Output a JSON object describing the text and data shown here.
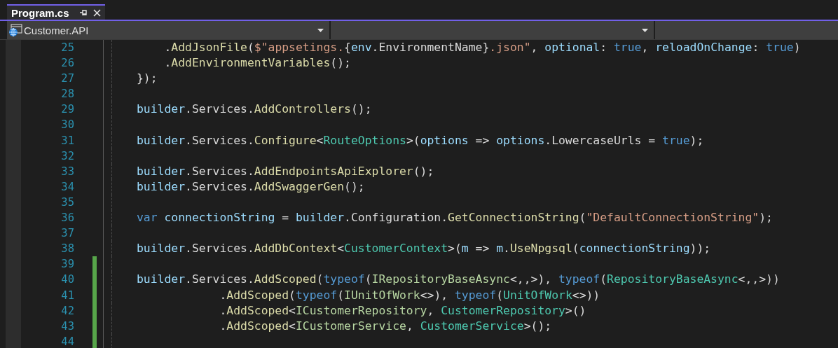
{
  "tab": {
    "title": "Program.cs",
    "selected": true
  },
  "project_dropdown": {
    "value": "Customer.API"
  },
  "lines": [
    {
      "number": "25",
      "modified": false,
      "tokens": [
        {
          "kind": "plain",
          "text": "    ."
        },
        {
          "kind": "method",
          "text": "AddJsonFile"
        },
        {
          "kind": "plain",
          "text": "("
        },
        {
          "kind": "string",
          "text": "$\"appsetings."
        },
        {
          "kind": "plain",
          "text": "{"
        },
        {
          "kind": "variable",
          "text": "env"
        },
        {
          "kind": "plain",
          "text": ".EnvironmentName}"
        },
        {
          "kind": "string",
          "text": ".json\""
        },
        {
          "kind": "plain",
          "text": ", "
        },
        {
          "kind": "variable",
          "text": "optional"
        },
        {
          "kind": "plain",
          "text": ": "
        },
        {
          "kind": "keyword",
          "text": "true"
        },
        {
          "kind": "plain",
          "text": ", "
        },
        {
          "kind": "variable",
          "text": "reloadOnChange"
        },
        {
          "kind": "plain",
          "text": ": "
        },
        {
          "kind": "keyword",
          "text": "true"
        },
        {
          "kind": "plain",
          "text": ")"
        }
      ]
    },
    {
      "number": "26",
      "modified": false,
      "tokens": [
        {
          "kind": "plain",
          "text": "    ."
        },
        {
          "kind": "method",
          "text": "AddEnvironmentVariables"
        },
        {
          "kind": "plain",
          "text": "();"
        }
      ]
    },
    {
      "number": "27",
      "modified": false,
      "tokens": [
        {
          "kind": "plain",
          "text": "});"
        }
      ]
    },
    {
      "number": "28",
      "modified": false
    },
    {
      "number": "29",
      "modified": false,
      "tokens": [
        {
          "kind": "variable",
          "text": "builder"
        },
        {
          "kind": "plain",
          "text": ".Services."
        },
        {
          "kind": "method",
          "text": "AddControllers"
        },
        {
          "kind": "plain",
          "text": "();"
        }
      ]
    },
    {
      "number": "30",
      "modified": false
    },
    {
      "number": "31",
      "modified": false,
      "tokens": [
        {
          "kind": "variable",
          "text": "builder"
        },
        {
          "kind": "plain",
          "text": ".Services."
        },
        {
          "kind": "method",
          "text": "Configure"
        },
        {
          "kind": "plain",
          "text": "<"
        },
        {
          "kind": "type",
          "text": "RouteOptions"
        },
        {
          "kind": "plain",
          "text": ">("
        },
        {
          "kind": "variable",
          "text": "options"
        },
        {
          "kind": "plain",
          "text": " => "
        },
        {
          "kind": "variable",
          "text": "options"
        },
        {
          "kind": "plain",
          "text": ".LowercaseUrls = "
        },
        {
          "kind": "keyword",
          "text": "true"
        },
        {
          "kind": "plain",
          "text": ");"
        }
      ]
    },
    {
      "number": "32",
      "modified": false
    },
    {
      "number": "33",
      "modified": false,
      "tokens": [
        {
          "kind": "variable",
          "text": "builder"
        },
        {
          "kind": "plain",
          "text": ".Services."
        },
        {
          "kind": "method",
          "text": "AddEndpointsApiExplorer"
        },
        {
          "kind": "plain",
          "text": "();"
        }
      ]
    },
    {
      "number": "34",
      "modified": false,
      "tokens": [
        {
          "kind": "variable",
          "text": "builder"
        },
        {
          "kind": "plain",
          "text": ".Services."
        },
        {
          "kind": "method",
          "text": "AddSwaggerGen"
        },
        {
          "kind": "plain",
          "text": "();"
        }
      ]
    },
    {
      "number": "35",
      "modified": false
    },
    {
      "number": "36",
      "modified": false,
      "tokens": [
        {
          "kind": "keyword",
          "text": "var"
        },
        {
          "kind": "variable",
          "text": " connectionString"
        },
        {
          "kind": "plain",
          "text": " = "
        },
        {
          "kind": "variable",
          "text": "builder"
        },
        {
          "kind": "plain",
          "text": ".Configuration."
        },
        {
          "kind": "method",
          "text": "GetConnectionString"
        },
        {
          "kind": "plain",
          "text": "("
        },
        {
          "kind": "string",
          "text": "\"DefaultConnectionString\""
        },
        {
          "kind": "plain",
          "text": ");"
        }
      ]
    },
    {
      "number": "37",
      "modified": false
    },
    {
      "number": "38",
      "modified": false,
      "tokens": [
        {
          "kind": "variable",
          "text": "builder"
        },
        {
          "kind": "plain",
          "text": ".Services."
        },
        {
          "kind": "method",
          "text": "AddDbContext"
        },
        {
          "kind": "plain",
          "text": "<"
        },
        {
          "kind": "type",
          "text": "CustomerContext"
        },
        {
          "kind": "plain",
          "text": ">("
        },
        {
          "kind": "variable",
          "text": "m"
        },
        {
          "kind": "plain",
          "text": " => "
        },
        {
          "kind": "variable",
          "text": "m"
        },
        {
          "kind": "plain",
          "text": "."
        },
        {
          "kind": "method",
          "text": "UseNpgsql"
        },
        {
          "kind": "plain",
          "text": "("
        },
        {
          "kind": "variable",
          "text": "connectionString"
        },
        {
          "kind": "plain",
          "text": "));"
        }
      ]
    },
    {
      "number": "39",
      "modified": true
    },
    {
      "number": "40",
      "modified": true,
      "tokens": [
        {
          "kind": "variable",
          "text": "builder"
        },
        {
          "kind": "plain",
          "text": ".Services."
        },
        {
          "kind": "method",
          "text": "AddScoped"
        },
        {
          "kind": "plain",
          "text": "("
        },
        {
          "kind": "keyword",
          "text": "typeof"
        },
        {
          "kind": "plain",
          "text": "("
        },
        {
          "kind": "interface",
          "text": "IRepositoryBaseAsync"
        },
        {
          "kind": "plain",
          "text": "<,,>), "
        },
        {
          "kind": "keyword",
          "text": "typeof"
        },
        {
          "kind": "plain",
          "text": "("
        },
        {
          "kind": "type",
          "text": "RepositoryBaseAsync"
        },
        {
          "kind": "plain",
          "text": "<,,>))"
        }
      ]
    },
    {
      "number": "41",
      "modified": true,
      "tokens": [
        {
          "kind": "plain",
          "text": "            ."
        },
        {
          "kind": "method",
          "text": "AddScoped"
        },
        {
          "kind": "plain",
          "text": "("
        },
        {
          "kind": "keyword",
          "text": "typeof"
        },
        {
          "kind": "plain",
          "text": "("
        },
        {
          "kind": "interface",
          "text": "IUnitOfWork"
        },
        {
          "kind": "plain",
          "text": "<>), "
        },
        {
          "kind": "keyword",
          "text": "typeof"
        },
        {
          "kind": "plain",
          "text": "("
        },
        {
          "kind": "type",
          "text": "UnitOfWork"
        },
        {
          "kind": "plain",
          "text": "<>))"
        }
      ]
    },
    {
      "number": "42",
      "modified": true,
      "tokens": [
        {
          "kind": "plain",
          "text": "            ."
        },
        {
          "kind": "method",
          "text": "AddScoped"
        },
        {
          "kind": "plain",
          "text": "<"
        },
        {
          "kind": "interface",
          "text": "ICustomerRepository"
        },
        {
          "kind": "plain",
          "text": ", "
        },
        {
          "kind": "type",
          "text": "CustomerRepository"
        },
        {
          "kind": "plain",
          "text": ">()"
        }
      ]
    },
    {
      "number": "43",
      "modified": true,
      "tokens": [
        {
          "kind": "plain",
          "text": "            ."
        },
        {
          "kind": "method",
          "text": "AddScoped"
        },
        {
          "kind": "plain",
          "text": "<"
        },
        {
          "kind": "interface",
          "text": "ICustomerService"
        },
        {
          "kind": "plain",
          "text": ", "
        },
        {
          "kind": "type",
          "text": "CustomerService"
        },
        {
          "kind": "plain",
          "text": ">();"
        }
      ]
    },
    {
      "number": "44",
      "modified": true
    }
  ]
}
